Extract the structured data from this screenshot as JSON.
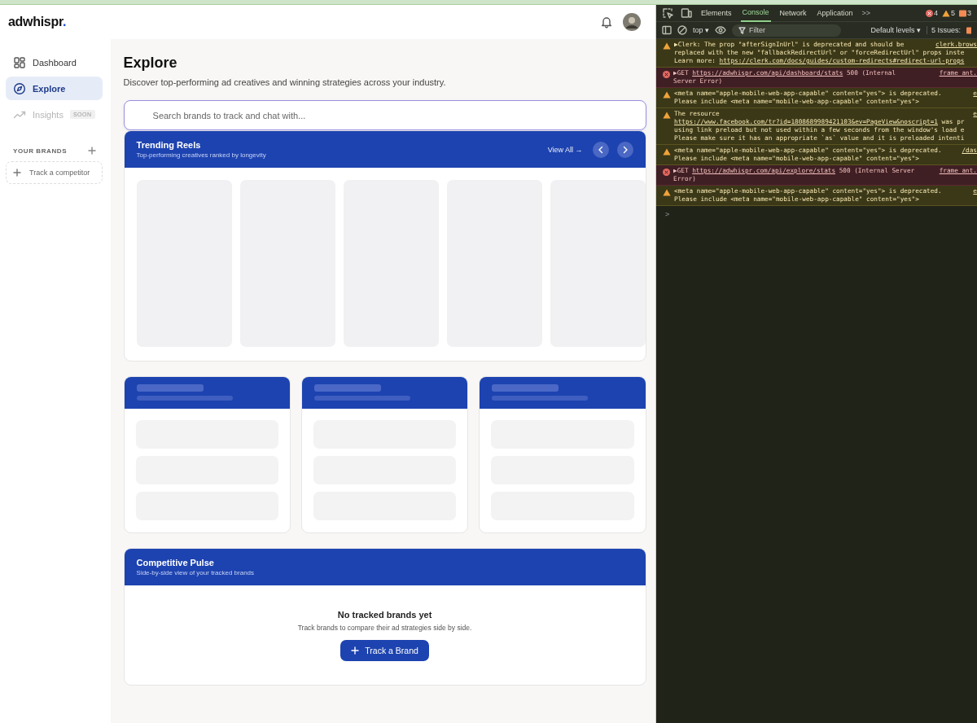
{
  "app": {
    "logo": {
      "name": "adwhispr",
      "dot": "."
    },
    "sidebar": {
      "items": [
        {
          "label": "Dashboard",
          "selected": false,
          "disabled": false
        },
        {
          "label": "Explore",
          "selected": true,
          "disabled": false
        },
        {
          "label": "Insights",
          "selected": false,
          "disabled": true,
          "badge": "SOON"
        }
      ],
      "brands_heading": "YOUR BRANDS",
      "track_competitor": "Track a competitor"
    },
    "page": {
      "title": "Explore",
      "subtitle": "Discover top-performing ad creatives and winning strategies across your industry.",
      "search": {
        "placeholder": "Search brands to track and chat with..."
      },
      "trending": {
        "title": "Trending Reels",
        "subtitle": "Top-performing creatives ranked by longevity",
        "view_all": "View All →",
        "items": [
          {
            "loading": true
          },
          {
            "loading": true
          },
          {
            "loading": true
          },
          {
            "loading": true
          },
          {
            "loading": true
          }
        ]
      },
      "panels": [
        {
          "loading": true
        },
        {
          "loading": true
        },
        {
          "loading": true
        }
      ],
      "pulse": {
        "title": "Competitive Pulse",
        "subtitle": "Side-by-side view of your tracked brands",
        "empty_title": "No tracked brands yet",
        "empty_text": "Track brands to compare their ad strategies side by side.",
        "button": "Track a Brand"
      }
    }
  },
  "devtools": {
    "tabs": [
      {
        "label": "Elements",
        "selected": false
      },
      {
        "label": "Console",
        "selected": true
      },
      {
        "label": "Network",
        "selected": false
      },
      {
        "label": "Application",
        "selected": false
      }
    ],
    "more": ">>",
    "counts": {
      "errors": "4",
      "warnings": "5",
      "issues": "3"
    },
    "context": "top ▾",
    "filter": {
      "placeholder": "Filter"
    },
    "levels": "Default levels ▾",
    "issues_label": "5 Issues:",
    "messages": [
      {
        "kind": "warning",
        "source": "clerk.brows",
        "lines": [
          [
            {
              "text": "▶Clerk: The prop \"afterSignInUrl\" is deprecated and should be"
            }
          ],
          [
            {
              "text": "replaced with the new \"fallbackRedirectUrl\" or \"forceRedirectUrl\" props inste"
            }
          ],
          [
            {
              "text": "Learn more: "
            },
            {
              "text": "https://clerk.com/docs/guides/custom-redirects#redirect-url-props",
              "link": true
            }
          ]
        ]
      },
      {
        "kind": "error",
        "source": "frame_ant.",
        "lines": [
          [
            {
              "text": "▶GET "
            },
            {
              "text": "https://adwhispr.com/api/dashboard/stats",
              "link": true
            },
            {
              "text": " 500 (Internal"
            }
          ],
          [
            {
              "text": "Server Error)"
            }
          ]
        ]
      },
      {
        "kind": "warning",
        "source": "e",
        "lines": [
          [
            {
              "text": "<meta name=\"apple-mobile-web-app-capable\" content=\"yes\"> is deprecated."
            }
          ],
          [
            {
              "text": "Please include <meta name=\"mobile-web-app-capable\" content=\"yes\">"
            }
          ]
        ]
      },
      {
        "kind": "warning",
        "source": "e",
        "lines": [
          [
            {
              "text": "The resource"
            }
          ],
          [
            {
              "text": "https://www.facebook.com/tr?id=1808689989421103&ev=PageView&noscript=1",
              "link": true
            },
            {
              "text": " was pr"
            }
          ],
          [
            {
              "text": "using link preload but not used within a few seconds from the window's load e"
            }
          ],
          [
            {
              "text": "Please make sure it has an appropriate `as` value and it is preloaded intenti"
            }
          ]
        ]
      },
      {
        "kind": "warning",
        "source": "/das",
        "lines": [
          [
            {
              "text": "<meta name=\"apple-mobile-web-app-capable\" content=\"yes\"> is deprecated."
            }
          ],
          [
            {
              "text": "Please include <meta name=\"mobile-web-app-capable\" content=\"yes\">"
            }
          ]
        ]
      },
      {
        "kind": "error",
        "source": "frame_ant.",
        "lines": [
          [
            {
              "text": "▶GET "
            },
            {
              "text": "https://adwhispr.com/api/explore/stats",
              "link": true
            },
            {
              "text": " 500 (Internal Server"
            }
          ],
          [
            {
              "text": "Error)"
            }
          ]
        ]
      },
      {
        "kind": "warning",
        "source": "e",
        "lines": [
          [
            {
              "text": "<meta name=\"apple-mobile-web-app-capable\" content=\"yes\"> is deprecated."
            }
          ],
          [
            {
              "text": "Please include <meta name=\"mobile-web-app-capable\" content=\"yes\">"
            }
          ]
        ]
      }
    ],
    "prompt": ">"
  }
}
